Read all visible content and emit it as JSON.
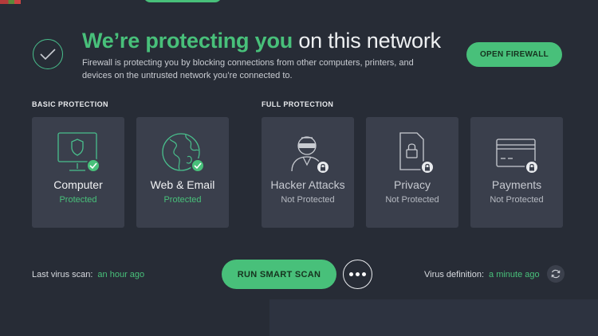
{
  "header": {
    "headline_accent": "We’re protecting you",
    "headline_rest": " on this network",
    "description": "Firewall is protecting you by blocking connections from other computers, printers, and devices on the untrusted network you’re connected to.",
    "open_firewall_label": "OPEN FIREWALL"
  },
  "sections": {
    "basic": "BASIC PROTECTION",
    "full": "FULL PROTECTION"
  },
  "cards": [
    {
      "title": "Computer",
      "status": "Protected",
      "icon": "computer-shield-icon"
    },
    {
      "title": "Web & Email",
      "status": "Protected",
      "icon": "globe-icon"
    },
    {
      "title": "Hacker Attacks",
      "status": "Not Protected",
      "icon": "hacker-icon"
    },
    {
      "title": "Privacy",
      "status": "Not Protected",
      "icon": "privacy-lock-icon"
    },
    {
      "title": "Payments",
      "status": "Not Protected",
      "icon": "credit-card-icon"
    }
  ],
  "footer": {
    "last_scan_label": "Last virus scan:",
    "last_scan_value": "an hour ago",
    "run_scan_label": "RUN SMART SCAN",
    "definition_label": "Virus definition:",
    "definition_value": "a minute ago"
  },
  "colors": {
    "background": "#272c36",
    "card": "#3a3f4c",
    "accent": "#48c07a"
  }
}
